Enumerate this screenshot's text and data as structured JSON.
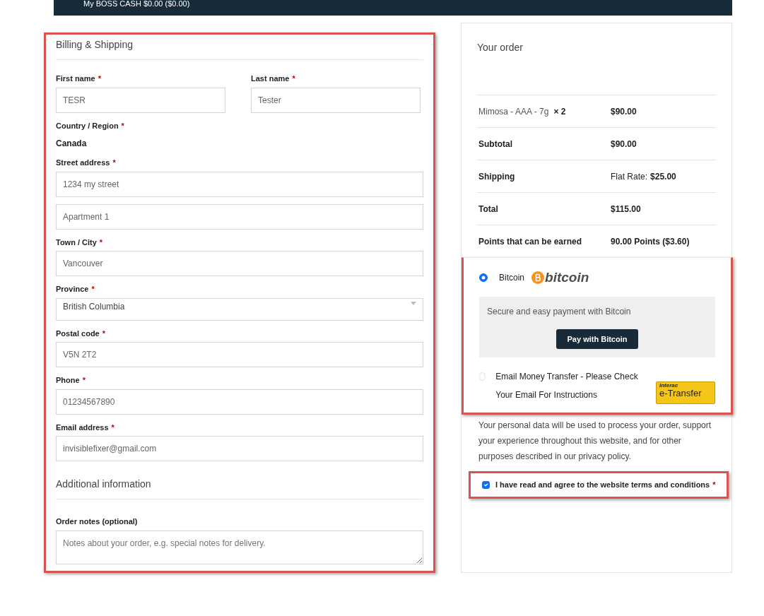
{
  "top_bar": {
    "text": "My BOSS CASH $0.00 ($0.00)"
  },
  "billing": {
    "title": "Billing & Shipping",
    "highlighted": true,
    "fields": [
      {
        "kind": "input",
        "label": "First name",
        "required_mark": "*",
        "value": "TESR",
        "half": true
      },
      {
        "kind": "input",
        "label": "Last name",
        "required_mark": "*",
        "value": "Tester",
        "half": true
      },
      {
        "kind": "static",
        "label": "Country / Region",
        "required_mark": "*",
        "value": "Canada"
      },
      {
        "kind": "input",
        "label": "Street address",
        "required_mark": "*",
        "value": "1234 my street"
      },
      {
        "kind": "input",
        "value": "Apartment 1"
      },
      {
        "kind": "input",
        "label": "Town / City",
        "required_mark": "*",
        "value": "Vancouver"
      },
      {
        "kind": "select",
        "label": "Province",
        "required_mark": "*",
        "value": "British Columbia"
      },
      {
        "kind": "input",
        "label": "Postal code",
        "required_mark": "*",
        "value": "V5N 2T2"
      },
      {
        "kind": "input",
        "label": "Phone",
        "required_mark": "*",
        "value": "01234567890"
      },
      {
        "kind": "input",
        "label": "Email address",
        "required_mark": "*",
        "value": "invisiblefixer@gmail.com"
      }
    ]
  },
  "additional": {
    "title": "Additional information",
    "notes_label": "Order notes (optional)",
    "notes_placeholder": "Notes about your order, e.g. special notes for delivery."
  },
  "order": {
    "title": "Your order",
    "rows": [
      {
        "kind": "item",
        "label": "Mimosa - AAA - 7g",
        "qty": "× 2",
        "value": "$90.00"
      },
      {
        "kind": "total",
        "label": "Subtotal",
        "value": "$90.00"
      },
      {
        "kind": "total",
        "label": "Shipping",
        "prefix": "Flat Rate:",
        "value": "$25.00"
      },
      {
        "kind": "total",
        "label": "Total",
        "value": "$115.00"
      },
      {
        "kind": "total",
        "label": "Points that can be earned",
        "value": "90.00 Points ($3.60)"
      }
    ]
  },
  "payment": {
    "highlighted": true,
    "methods": [
      {
        "kind": "bitcoin",
        "label": "Bitcoin",
        "logo_text": "bitcoin",
        "selected": true,
        "description": "Secure and easy payment with Bitcoin",
        "button": "Pay with Bitcoin"
      },
      {
        "kind": "interac",
        "label": "Email Money Transfer - Please Check Your Email For Instructions",
        "logo_text": "Interac",
        "logo_text_2": "e-Transfer",
        "selected": false
      }
    ]
  },
  "privacy": {
    "text": "Your personal data will be used to process your order, support your experience throughout this website, and for other purposes described in our",
    "link": "privacy policy",
    "end": "."
  },
  "terms": {
    "highlighted": true,
    "checked": true,
    "label": "I have read and agree to the website",
    "link": "terms and conditions",
    "required_mark": "*"
  }
}
